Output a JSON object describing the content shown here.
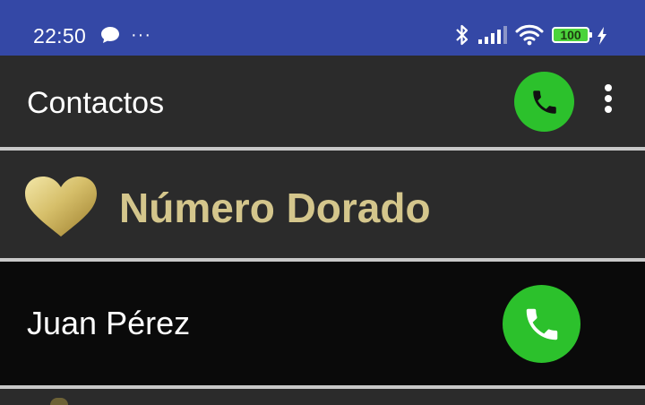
{
  "status_bar": {
    "time": "22:50",
    "overflow_dots": "···",
    "battery_level": "100",
    "icons": [
      "chat-bubble-icon",
      "bluetooth-icon",
      "signal-icon",
      "wifi-icon",
      "battery-icon",
      "charging-bolt-icon"
    ],
    "background_color": "#3448a6",
    "battery_color": "#4bd33b"
  },
  "app_bar": {
    "title": "Contactos",
    "call_icon": "phone-icon",
    "menu_icon": "more-vert-icon",
    "accent_color": "#2cc12c"
  },
  "golden": {
    "icon": "heart-icon",
    "label": "Número Dorado",
    "color": "#d4c68c"
  },
  "contacts": [
    {
      "name": "Juan Pérez",
      "call_icon": "phone-icon"
    }
  ]
}
